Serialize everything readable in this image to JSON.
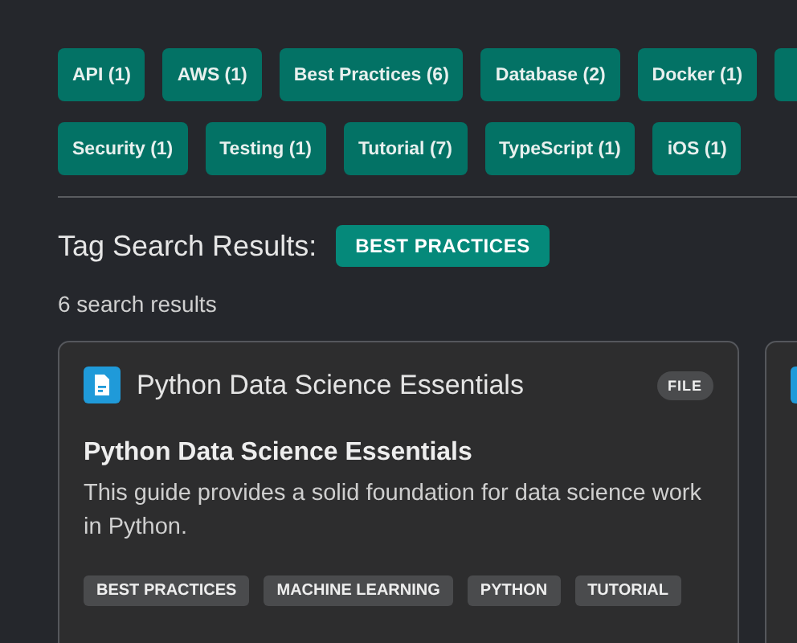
{
  "tag_rows": [
    {
      "tags": [
        "API (1)",
        "AWS (1)",
        "Best Practices (6)",
        "Database (2)",
        "Docker (1)"
      ],
      "overflow": true
    },
    {
      "tags": [
        "Security (1)",
        "Testing (1)",
        "Tutorial (7)",
        "TypeScript (1)",
        "iOS (1)"
      ],
      "overflow": false
    }
  ],
  "results": {
    "heading": "Tag Search Results:",
    "active_tag": "BEST PRACTICES",
    "count": "6 search results",
    "cards": [
      {
        "kind": "file",
        "title": "Python Data Science Essentials",
        "badge": "FILE",
        "heading": "Python Data Science Essentials",
        "description": "This guide provides a solid foundation for data science work in Python.",
        "tags": [
          "BEST PRACTICES",
          "MACHINE LEARNING",
          "PYTHON",
          "TUTORIAL"
        ]
      }
    ],
    "more_cards_cut": true
  }
}
